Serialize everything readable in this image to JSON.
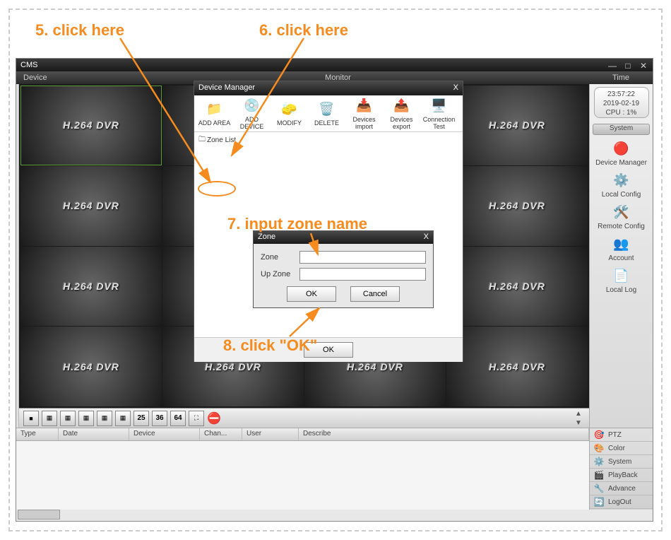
{
  "annotations": {
    "step5": "5. click here",
    "step6": "6. click here",
    "step7": "7. input zone name",
    "step8": "8. click \"OK\""
  },
  "app": {
    "title": "CMS",
    "subheader": {
      "device": "Device",
      "monitor": "Monitor",
      "time": "Time"
    },
    "clock": {
      "time": "23:57:22",
      "date": "2019-02-19",
      "cpu": "CPU : 1%"
    },
    "video_label": "H.264 DVR",
    "system": {
      "header": "System",
      "items": [
        "Device Manager",
        "Local Config",
        "Remote Config",
        "Account",
        "Local Log"
      ]
    },
    "grid_numbers": [
      "25",
      "36",
      "64"
    ],
    "event_cols": [
      "Type",
      "Date",
      "Device",
      "Chan...",
      "User",
      "Describe"
    ],
    "side_buttons": [
      "PTZ",
      "Color",
      "System",
      "PlayBack",
      "Advance",
      "LogOut"
    ]
  },
  "device_manager": {
    "title": "Device Manager",
    "close": "X",
    "toolbar": [
      "ADD AREA",
      "ADD DEVICE",
      "MODIFY",
      "DELETE",
      "Devices import",
      "Devices export",
      "Connection Test"
    ],
    "tree_root": "Zone List",
    "ok": "OK"
  },
  "zone_dialog": {
    "title": "Zone",
    "close": "X",
    "fields": {
      "zone": "Zone",
      "upzone": "Up Zone"
    },
    "zone_value": "",
    "upzone_value": "",
    "ok": "OK",
    "cancel": "Cancel"
  }
}
